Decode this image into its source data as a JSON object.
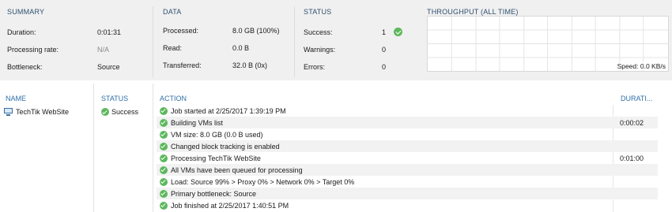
{
  "summary": {
    "title": "SUMMARY",
    "rows": [
      {
        "label": "Duration:",
        "value": "0:01:31"
      },
      {
        "label": "Processing rate:",
        "value": "N/A"
      },
      {
        "label": "Bottleneck:",
        "value": "Source"
      }
    ]
  },
  "data": {
    "title": "DATA",
    "rows": [
      {
        "label": "Processed:",
        "value": "8.0 GB (100%)"
      },
      {
        "label": "Read:",
        "value": "0.0 B"
      },
      {
        "label": "Transferred:",
        "value": "32.0 B (0x)"
      }
    ]
  },
  "status": {
    "title": "STATUS",
    "rows": [
      {
        "label": "Success:",
        "value": "1"
      },
      {
        "label": "Warnings:",
        "value": "0"
      },
      {
        "label": "Errors:",
        "value": "0"
      }
    ]
  },
  "throughput": {
    "title": "THROUGHPUT (ALL TIME)",
    "speed": "Speed: 0.0 KB/s"
  },
  "columns": {
    "name": "NAME",
    "status": "STATUS",
    "action": "ACTION",
    "duration": "DURATI..."
  },
  "vm": {
    "name": "TechTik WebSite",
    "status": "Success"
  },
  "log": [
    {
      "text": "Job started at 2/25/2017 1:39:19 PM",
      "duration": ""
    },
    {
      "text": "Building VMs list",
      "duration": "0:00:02"
    },
    {
      "text": "VM size: 8.0 GB (0.0 B used)",
      "duration": ""
    },
    {
      "text": "Changed block tracking is enabled",
      "duration": ""
    },
    {
      "text": "Processing TechTik WebSite",
      "duration": "0:01:00"
    },
    {
      "text": "All VMs have been queued for processing",
      "duration": ""
    },
    {
      "text": "Load: Source 99% > Proxy 0% > Network 0% > Target 0%",
      "duration": ""
    },
    {
      "text": "Primary bottleneck: Source",
      "duration": ""
    },
    {
      "text": "Job finished at 2/25/2017 1:40:51 PM",
      "duration": ""
    }
  ],
  "colors": {
    "success_green": "#5cb85c",
    "section_title": "#2f4f6f",
    "column_header": "#2f6fa8",
    "panel_bg": "#f0f0f0"
  },
  "icons": {
    "success": "check-circle-icon",
    "vm": "vm-monitor-icon"
  }
}
